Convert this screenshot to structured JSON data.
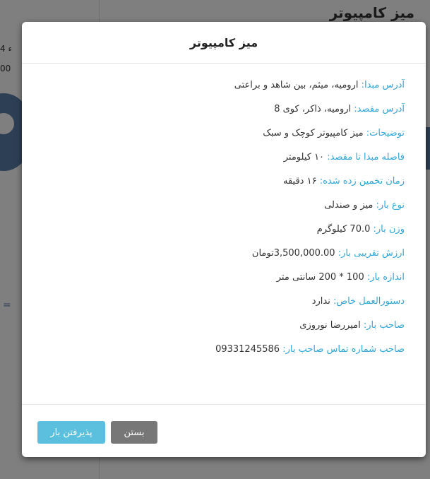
{
  "background": {
    "title": "میز کامپیوتر",
    "fragment1": "4 ء",
    "fragment2": "00",
    "fragment3": "="
  },
  "modal": {
    "title": "میز کامپیوتر",
    "fields": [
      {
        "label": "آدرس مبدا:",
        "value": " ارومیه، میثم، بین شاهد و براعتی"
      },
      {
        "label": "آدرس مقصد:",
        "value": " ارومیه، ذاکر، کوی 8"
      },
      {
        "label": "توضیحات:",
        "value": " میز کامپیوتر کوچک و سبک"
      },
      {
        "label": "فاصله مبدا تا مقصد:",
        "value": " ۱۰ کیلومتر"
      },
      {
        "label": "زمان تخمین زده شده:",
        "value": " ۱۶ دقیقه"
      },
      {
        "label": "نوع بار:",
        "value": " میز و صندلی"
      },
      {
        "label": "وزن بار:",
        "value": " 70.0 کیلوگرم"
      },
      {
        "label": "ارزش تقریبی بار:",
        "value": " 3,500,000.00تومان"
      },
      {
        "label": "اندازه بار:",
        "value": " 100 * 200 سانتی متر"
      },
      {
        "label": "دستورالعمل خاص:",
        "value": " ندارد"
      },
      {
        "label": "صاحب بار:",
        "value": " امیررضا نوروزی"
      },
      {
        "label": "صاحب شماره تماس صاحب بار:",
        "value": " 09331245586"
      }
    ],
    "buttons": {
      "close": "بستن",
      "accept": "پذیرفتن بار"
    }
  },
  "colors": {
    "label": "#2fa6d9",
    "accept_button": "#5bc0de",
    "close_button": "#777777"
  }
}
